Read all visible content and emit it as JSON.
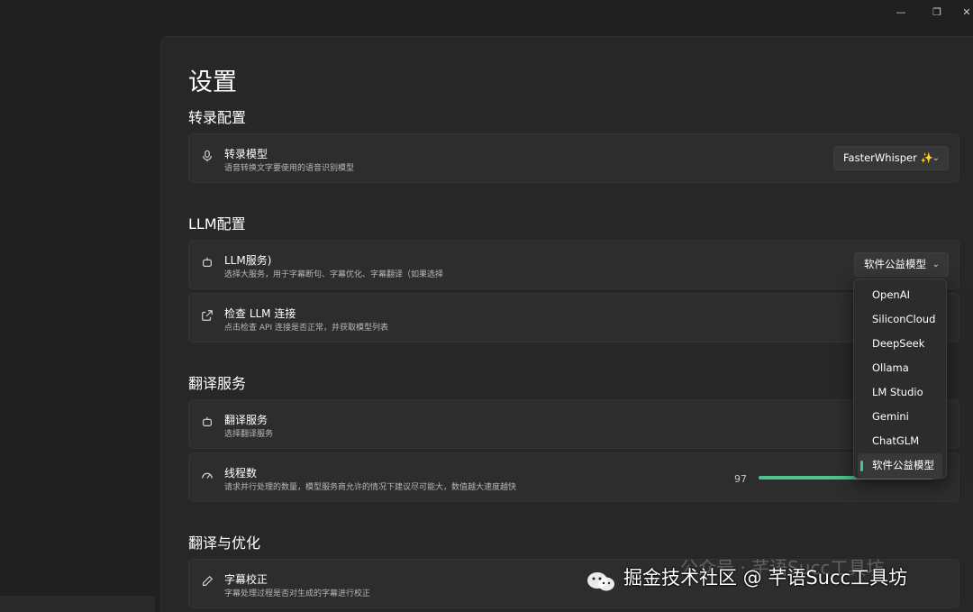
{
  "window": {
    "minimize_icon": "minimize-icon",
    "maximize_icon": "restore-icon",
    "close_icon": "close-icon"
  },
  "page": {
    "title": "设置"
  },
  "sections": {
    "transcribe": {
      "title": "转录配置",
      "model": {
        "title": "转录模型",
        "desc": "语音转换文字要使用的语音识别模型",
        "value": "FasterWhisper",
        "icon": "microphone-icon"
      }
    },
    "llm": {
      "title": "LLM配置",
      "service": {
        "title": "LLM服务)",
        "desc": "选择大服务，用于字幕断句、字幕优化、字幕翻译（如果选择",
        "value": "软件公益模型",
        "icon": "robot-icon"
      },
      "check": {
        "title": "检查 LLM 连接",
        "desc": "点击检查 API 连接是否正常，并获取模型列表",
        "icon": "external-link-icon"
      }
    },
    "translate": {
      "title": "翻译服务",
      "service": {
        "title": "翻译服务",
        "desc": "选择翻译服务",
        "icon": "robot-icon"
      },
      "threads": {
        "title": "线程数",
        "desc": "请求并行处理的数量，模型服务商允许的情况下建议尽可能大，数值越大速度越快",
        "value": "97",
        "fraction": 0.97,
        "icon": "speedometer-icon"
      }
    },
    "optimize": {
      "title": "翻译与优化",
      "subtitle_fix": {
        "title": "字幕校正",
        "desc": "字幕处理过程是否对生成的字幕进行校正",
        "icon": "pencil-icon"
      }
    }
  },
  "dropdown": {
    "items": [
      "OpenAI",
      "SiliconCloud",
      "DeepSeek",
      "Ollama",
      "LM Studio",
      "Gemini",
      "ChatGLM",
      "软件公益模型"
    ],
    "selected": "软件公益模型"
  },
  "watermark": {
    "text": "掘金技术社区 @ 芊语Succ工具坊",
    "ghost_text": "公众号 · 芊语Succ工具坊"
  },
  "colors": {
    "accent": "#4cc38a",
    "background": "#202020",
    "card": "#2d2d2d"
  }
}
